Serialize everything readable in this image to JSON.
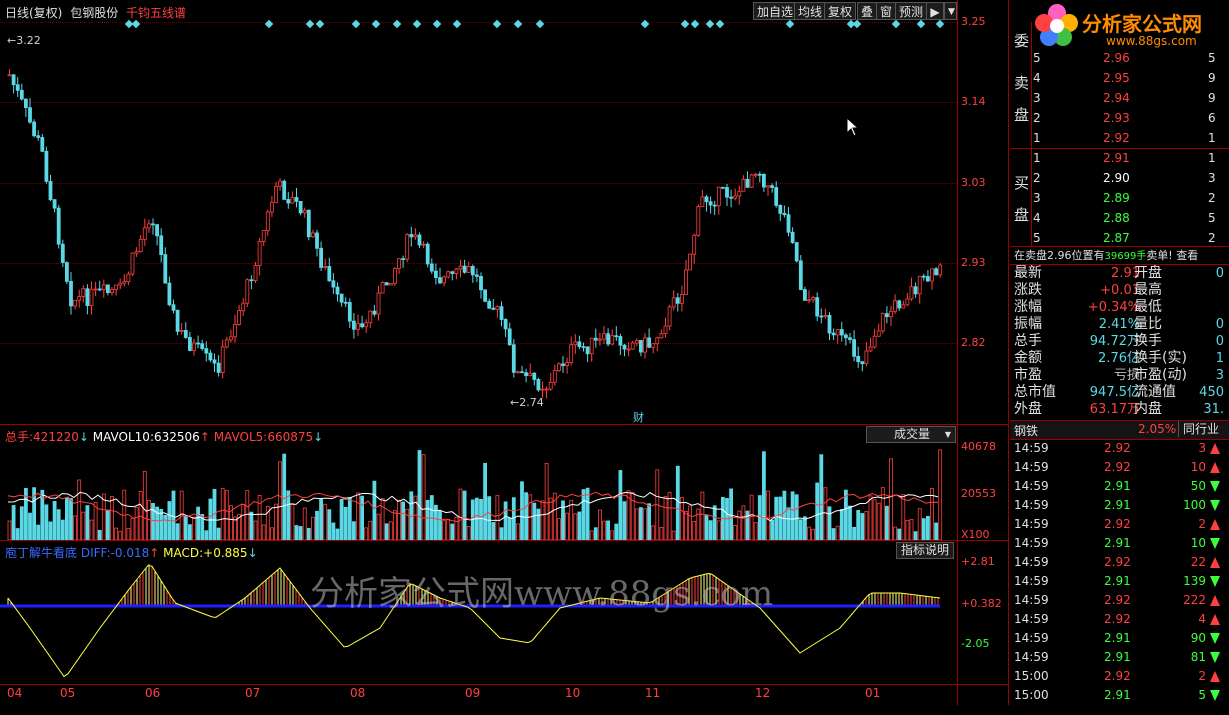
{
  "header": {
    "title": "日线(复权)",
    "stock_name": "包钢股份",
    "formula": "千钧五线谱"
  },
  "toolbar": {
    "add_watch": "加自选",
    "ma_line": "均线",
    "restore_rights": "复权",
    "overlay": "叠",
    "window": "窗",
    "forecast": "预测"
  },
  "price_axis": [
    "3.25",
    "3.14",
    "3.03",
    "2.93",
    "2.82"
  ],
  "price_annotations": {
    "high": "3.22",
    "low": "2.74",
    "event_marker": "财"
  },
  "volume_panel": {
    "total_label": "总手:",
    "total_value": "421220",
    "mavol10_label": "MAVOL10:",
    "mavol10_value": "632506",
    "mavol5_label": "MAVOL5:",
    "mavol5_value": "660875",
    "selector": "成交量",
    "axis_top": "40678",
    "axis_mid": "20553",
    "axis_unit": "X100"
  },
  "macd_panel": {
    "name": "庖丁解牛看底",
    "diff_label": "DIFF:",
    "diff_value": "-0.018",
    "macd_label": "MACD:",
    "macd_value": "+0.885",
    "help_button": "指标说明",
    "axis_top": "+2.81",
    "axis_mid": "+0.382",
    "axis_low": "-2.05"
  },
  "x_axis": [
    "04",
    "05",
    "06",
    "07",
    "08",
    "09",
    "10",
    "11",
    "12",
    "01"
  ],
  "watermark": "分析家公式网www.88gs.com",
  "logo": {
    "text": "分析家公式网",
    "url": "www.88gs.com"
  },
  "orderbook": {
    "title": "委",
    "sell_label": [
      "卖",
      "盘"
    ],
    "buy_label": [
      "买",
      "盘"
    ],
    "sell": [
      {
        "level": "5",
        "price": "2.96",
        "vol": "5"
      },
      {
        "level": "4",
        "price": "2.95",
        "vol": "9"
      },
      {
        "level": "3",
        "price": "2.94",
        "vol": "9"
      },
      {
        "level": "2",
        "price": "2.93",
        "vol": "6"
      },
      {
        "level": "1",
        "price": "2.92",
        "vol": "1"
      }
    ],
    "buy": [
      {
        "level": "1",
        "price": "2.91",
        "vol": "1"
      },
      {
        "level": "2",
        "price": "2.90",
        "vol": "3"
      },
      {
        "level": "3",
        "price": "2.89",
        "vol": "2"
      },
      {
        "level": "4",
        "price": "2.88",
        "vol": "5"
      },
      {
        "level": "5",
        "price": "2.87",
        "vol": "2"
      }
    ],
    "notice_prefix": "在卖盘2.96位置有",
    "notice_amount": "39699手",
    "notice_suffix": "卖单! 查看"
  },
  "stats": [
    {
      "l": "最新",
      "v": "2.91",
      "l2": "开盘",
      "c": "red"
    },
    {
      "l": "涨跌",
      "v": "+0.01",
      "l2": "最高",
      "c": "red"
    },
    {
      "l": "涨幅",
      "v": "+0.34%",
      "l2": "最低",
      "c": "red"
    },
    {
      "l": "振幅",
      "v": "2.41%",
      "l2": "量比",
      "c": "cyan"
    },
    {
      "l": "总手",
      "v": "94.72万",
      "l2": "换手",
      "c": "cyan"
    },
    {
      "l": "金额",
      "v": "2.76亿",
      "l2": "换手(实)",
      "c": "cyan"
    },
    {
      "l": "市盈",
      "v": "亏损",
      "l2": "市盈(动)",
      "c": "grey"
    },
    {
      "l": "总市值",
      "v": "947.5亿",
      "l2": "流通值",
      "c": "cyan"
    },
    {
      "l": "外盘",
      "v": "63.17万",
      "l2": "内盘",
      "c": "red"
    }
  ],
  "stats_right": [
    "0",
    "",
    "",
    "0",
    "0",
    "1",
    "3",
    "450",
    "31."
  ],
  "sector": {
    "name": "钢铁",
    "change": "2.05%",
    "peer_button": "同行业"
  },
  "ticks": [
    {
      "t": "14:59",
      "p": "2.92",
      "v": "3",
      "d": "up"
    },
    {
      "t": "14:59",
      "p": "2.92",
      "v": "10",
      "d": "up"
    },
    {
      "t": "14:59",
      "p": "2.91",
      "v": "50",
      "d": "down"
    },
    {
      "t": "14:59",
      "p": "2.91",
      "v": "100",
      "d": "down"
    },
    {
      "t": "14:59",
      "p": "2.92",
      "v": "2",
      "d": "up"
    },
    {
      "t": "14:59",
      "p": "2.91",
      "v": "10",
      "d": "down"
    },
    {
      "t": "14:59",
      "p": "2.92",
      "v": "22",
      "d": "up"
    },
    {
      "t": "14:59",
      "p": "2.91",
      "v": "139",
      "d": "down"
    },
    {
      "t": "14:59",
      "p": "2.92",
      "v": "222",
      "d": "up"
    },
    {
      "t": "14:59",
      "p": "2.92",
      "v": "4",
      "d": "up"
    },
    {
      "t": "14:59",
      "p": "2.91",
      "v": "90",
      "d": "down"
    },
    {
      "t": "14:59",
      "p": "2.91",
      "v": "81",
      "d": "down"
    },
    {
      "t": "15:00",
      "p": "2.92",
      "v": "2",
      "d": "up"
    },
    {
      "t": "15:00",
      "p": "2.91",
      "v": "5",
      "d": "down"
    }
  ],
  "colors": {
    "up": "#ff4040",
    "down": "#5ad8e6",
    "grid": "#9a0000",
    "macd_zero": "#2020ff",
    "diff_line": "#ffff40"
  }
}
